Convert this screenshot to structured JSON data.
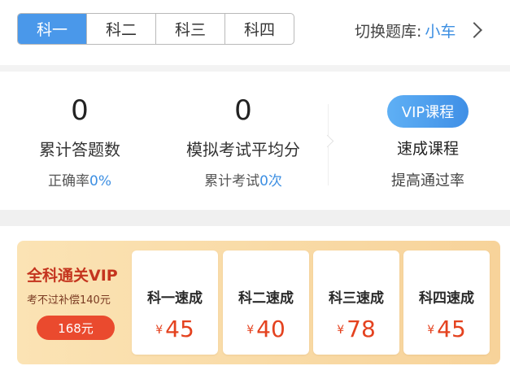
{
  "subject_tabs": [
    {
      "label": "科一",
      "active": true
    },
    {
      "label": "科二",
      "active": false
    },
    {
      "label": "科三",
      "active": false
    },
    {
      "label": "科四",
      "active": false
    }
  ],
  "question_bank": {
    "label": "切换题库:",
    "value": "小车"
  },
  "stats": {
    "answered": {
      "value": "0",
      "label": "累计答题数",
      "sub_prefix": "正确率",
      "sub_value": "0%"
    },
    "exam": {
      "value": "0",
      "label": "模拟考试平均分",
      "sub_prefix": "累计考试",
      "sub_value": "0次"
    },
    "vip": {
      "badge": "VIP课程",
      "label": "速成课程",
      "sub": "提高通过率"
    }
  },
  "promo": {
    "title": "全科通关VIP",
    "subtitle": "考不过补偿140元",
    "price": "168元",
    "currency": "¥",
    "courses": [
      {
        "name": "科一速成",
        "price": "45"
      },
      {
        "name": "科二速成",
        "price": "40"
      },
      {
        "name": "科三速成",
        "price": "78"
      },
      {
        "name": "科四速成",
        "price": "45"
      }
    ]
  },
  "colors": {
    "accent": "#4a98ea",
    "highlight": "#3d8fe2",
    "promo_red": "#e4421f"
  }
}
